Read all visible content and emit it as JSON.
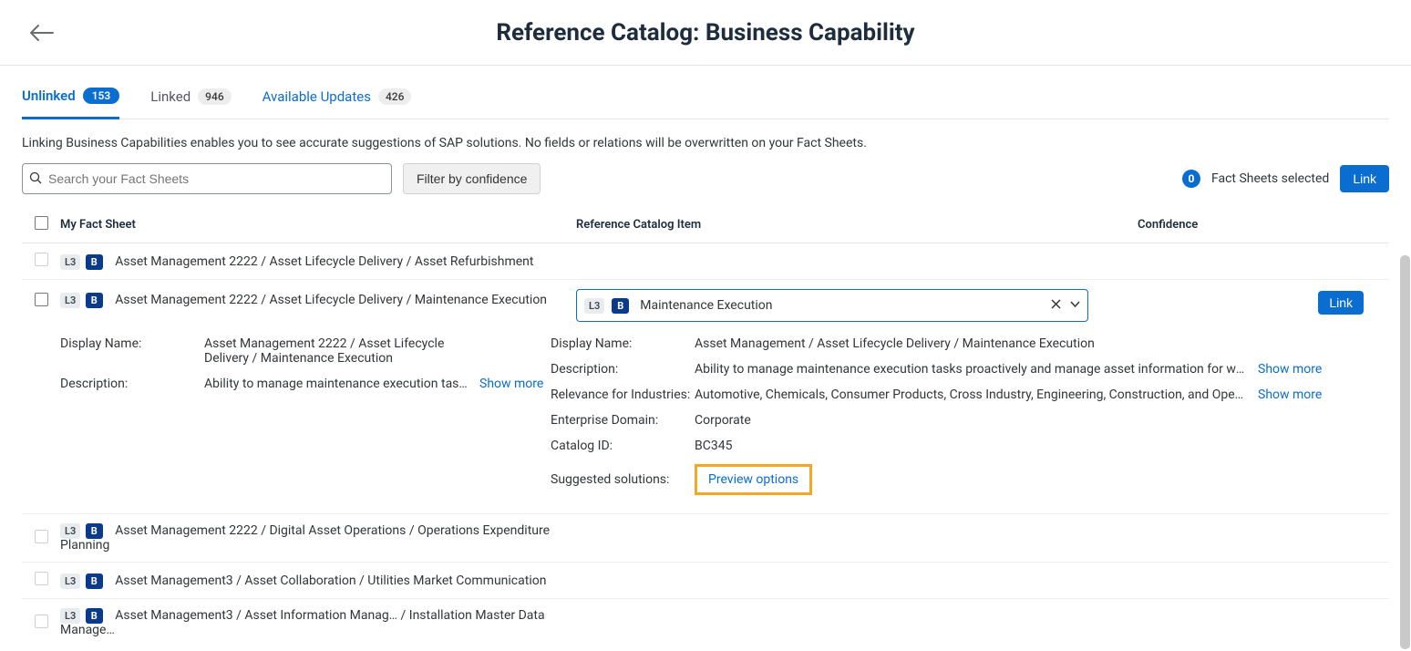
{
  "page_title": "Reference Catalog: Business Capability",
  "tabs": {
    "unlinked": {
      "label": "Unlinked",
      "count": "153"
    },
    "linked": {
      "label": "Linked",
      "count": "946"
    },
    "updates": {
      "label": "Available Updates",
      "count": "426"
    }
  },
  "help_text": "Linking Business Capabilities enables you to see accurate suggestions of SAP solutions. No fields or relations will be overwritten on your Fact Sheets.",
  "search_placeholder": "Search your Fact Sheets",
  "filter_label": "Filter by confidence",
  "selected_count": "0",
  "selected_label": "Fact Sheets selected",
  "link_button": "Link",
  "columns": {
    "fs": "My Fact Sheet",
    "ref": "Reference Catalog Item",
    "conf": "Confidence"
  },
  "rows": {
    "r0": {
      "level": "L3",
      "type": "B",
      "name": "Asset Management 2222 / Asset Lifecycle Delivery / Asset Refurbishment"
    },
    "r1": {
      "level": "L3",
      "type": "B",
      "name": "Asset Management 2222 / Asset Lifecycle Delivery / Maintenance Execution"
    },
    "r2": {
      "level": "L3",
      "type": "B",
      "name": "Asset Management 2222 / Digital Asset Operations / Operations Expenditure Planning"
    },
    "r3": {
      "level": "L3",
      "type": "B",
      "name": "Asset Management3 / Asset Collaboration / Utilities Market Communication"
    },
    "r4": {
      "level": "L3",
      "type": "B",
      "name": "Asset Management3 / Asset Information Manag… / Installation Master Data Manage…"
    }
  },
  "expanded": {
    "ref_select": {
      "level": "L3",
      "type": "B",
      "name": "Maintenance Execution"
    },
    "left": {
      "display_name_k": "Display Name:",
      "display_name_v": "Asset Management 2222 / Asset Lifecycle Delivery / Maintenance Execution",
      "description_k": "Description:",
      "description_v": "Ability to manage maintenance execution tasks …"
    },
    "right": {
      "display_name_k": "Display Name:",
      "display_name_v": "Asset Management / Asset Lifecycle Delivery / Maintenance Execution",
      "description_k": "Description:",
      "description_v": "Ability to manage maintenance execution tasks proactively and manage asset information for work or…",
      "relevance_k": "Relevance for Industries:",
      "relevance_v": "Automotive, Chemicals, Consumer Products, Cross Industry, Engineering, Construction, and Operatio…",
      "domain_k": "Enterprise Domain:",
      "domain_v": "Corporate",
      "catalog_k": "Catalog ID:",
      "catalog_v": "BC345",
      "suggested_k": "Suggested solutions:",
      "preview": "Preview options"
    },
    "show_more": "Show more"
  }
}
